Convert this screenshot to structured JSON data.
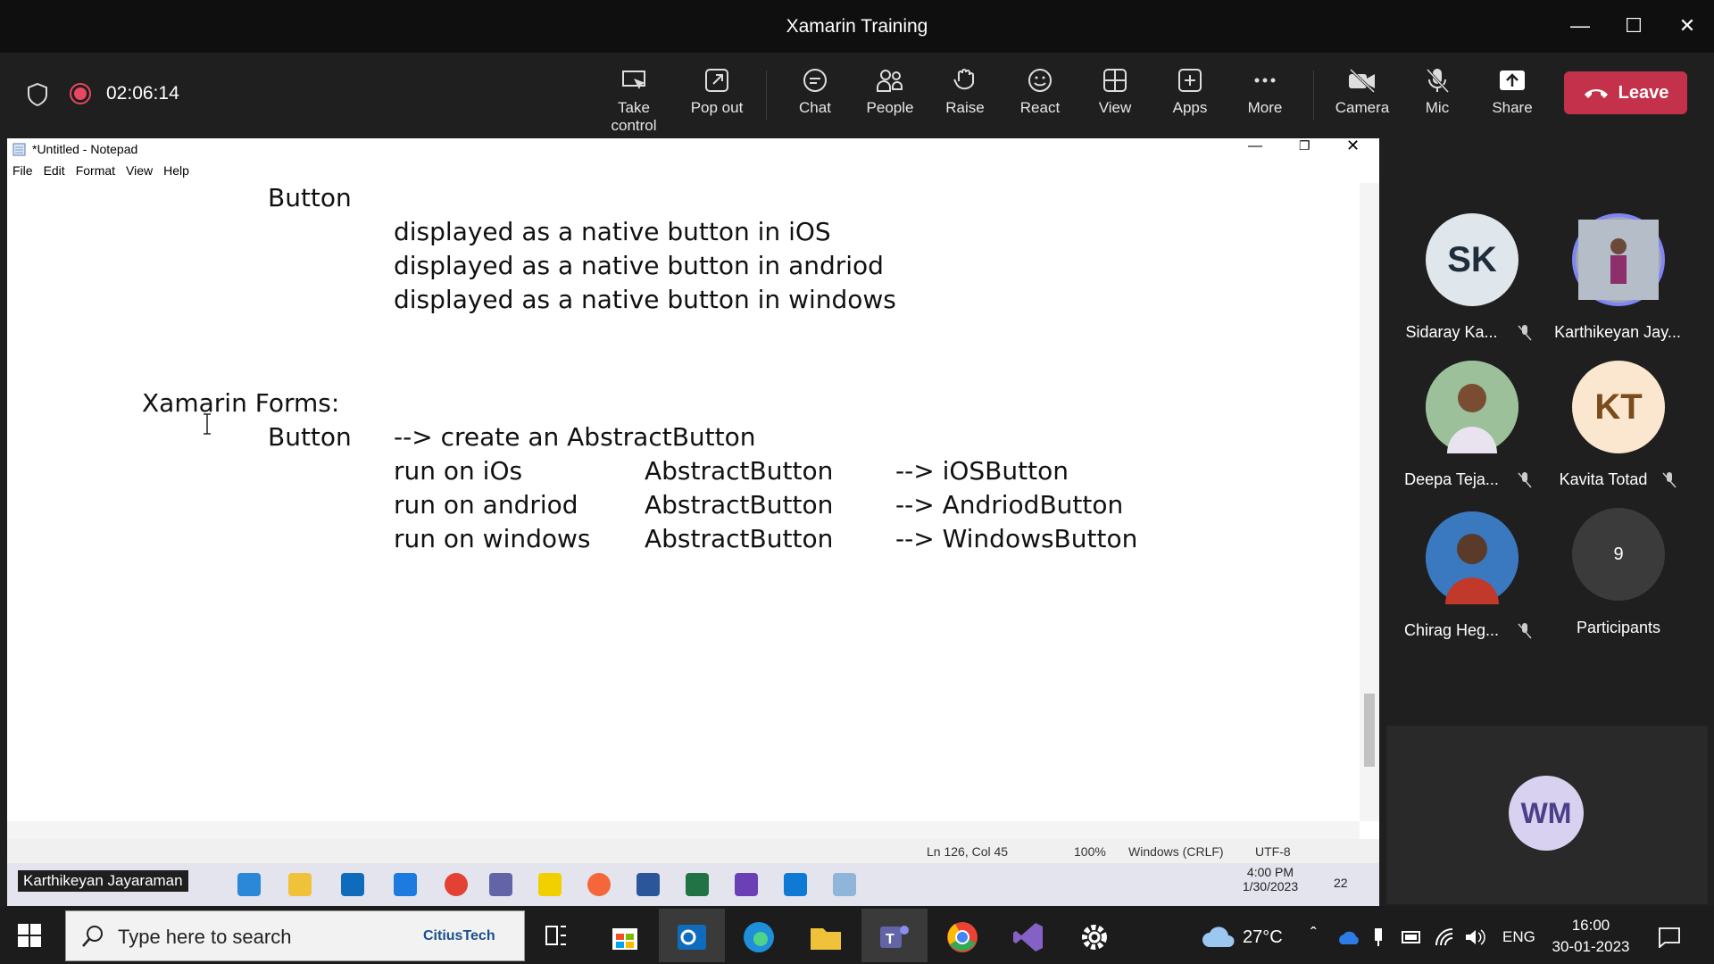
{
  "window": {
    "title": "Xamarin Training"
  },
  "meeting": {
    "timer": "02:06:14",
    "toolbar": [
      {
        "label": "Take control",
        "icon": "take-control-icon"
      },
      {
        "label": "Pop out",
        "icon": "pop-out-icon"
      },
      {
        "label": "Chat",
        "icon": "chat-icon"
      },
      {
        "label": "People",
        "icon": "people-icon"
      },
      {
        "label": "Raise",
        "icon": "raise-hand-icon"
      },
      {
        "label": "React",
        "icon": "react-icon"
      },
      {
        "label": "View",
        "icon": "view-icon"
      },
      {
        "label": "Apps",
        "icon": "apps-icon"
      },
      {
        "label": "More",
        "icon": "more-icon"
      },
      {
        "label": "Camera",
        "icon": "camera-off-icon"
      },
      {
        "label": "Mic",
        "icon": "mic-off-icon"
      },
      {
        "label": "Share",
        "icon": "share-icon"
      }
    ],
    "leave_label": "Leave",
    "presenter": "Karthikeyan Jayaraman",
    "accent": "#c4314b"
  },
  "notepad": {
    "title": "*Untitled - Notepad",
    "menu": [
      "File",
      "Edit",
      "Format",
      "View",
      "Help"
    ],
    "lines": {
      "l1": "Button",
      "l2": "displayed as a native button in iOS",
      "l3": "displayed as a native button in andriod",
      "l4": "displayed as a native button in windows",
      "l5": "Xamarin Forms:",
      "l6a": "Button",
      "l6b": "--> create an AbstractButton",
      "r1a": "run on iOs",
      "r1b": "AbstractButton",
      "r1c": "--> iOSButton",
      "r2a": "run on andriod",
      "r2b": "AbstractButton",
      "r2c": "--> AndriodButton",
      "r3a": "run on windows",
      "r3b": "AbstractButton",
      "r3c": "--> WindowsButton"
    },
    "status": {
      "position": "Ln 126, Col 45",
      "zoom": "100%",
      "eol": "Windows (CRLF)",
      "encoding": "UTF-8"
    }
  },
  "remote_taskbar": {
    "time": "4:00 PM",
    "date": "1/30/2023",
    "notifications": "22"
  },
  "participants": [
    {
      "initials": "SK",
      "name": "Sidaray Ka...",
      "muted": true
    },
    {
      "initials": "",
      "name": "Karthikeyan Jay...",
      "muted": false
    },
    {
      "initials": "",
      "name": "Deepa Teja...",
      "muted": true
    },
    {
      "initials": "KT",
      "name": "Kavita Totad",
      "muted": true
    },
    {
      "initials": "",
      "name": "Chirag Heg...",
      "muted": true
    },
    {
      "initials": "9",
      "name": "Participants",
      "muted": false
    }
  ],
  "self_tile": {
    "initials": "WM"
  },
  "taskbar": {
    "search_placeholder": "Type here to search",
    "search_brand": "CitiusTech",
    "weather": "27°C",
    "lang": "ENG",
    "time": "16:00",
    "date": "30-01-2023"
  }
}
